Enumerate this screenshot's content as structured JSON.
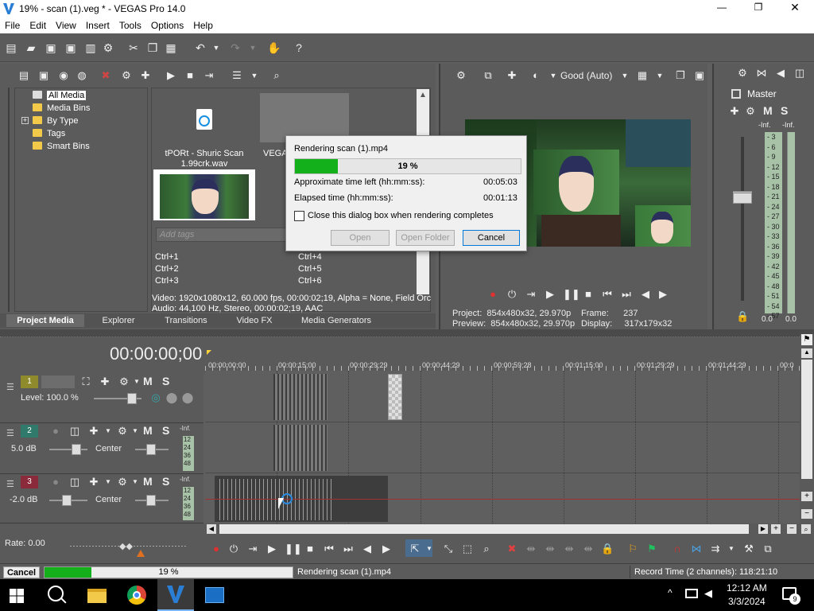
{
  "window": {
    "title": "19% - scan (1).veg * - VEGAS Pro 14.0",
    "controls": [
      "—",
      "❐",
      "✕"
    ]
  },
  "menu": [
    "File",
    "Edit",
    "View",
    "Insert",
    "Tools",
    "Options",
    "Help"
  ],
  "media_tree": {
    "items": [
      "All Media",
      "Media Bins",
      "By Type",
      "Tags",
      "Smart Bins"
    ],
    "expand_glyph": "+"
  },
  "media_files": [
    {
      "name": "tPORt - Shuric Scan 1.99crk.wav"
    },
    {
      "name": "VEGA"
    }
  ],
  "tags": {
    "placeholder": "Add tags",
    "shortcuts_left": [
      "Ctrl+1",
      "Ctrl+2",
      "Ctrl+3"
    ],
    "shortcuts_right": [
      "Ctrl+4",
      "Ctrl+5",
      "Ctrl+6"
    ]
  },
  "media_info": {
    "video": "Video: 1920x1080x12, 60.000 fps, 00:00:02;19, Alpha = None, Field Orc",
    "audio": "Audio: 44,100 Hz, Stereo, 00:00:02;19, AAC"
  },
  "bottom_tabs": [
    "Project Media",
    "Explorer",
    "Transitions",
    "Video FX",
    "Media Generators"
  ],
  "preview": {
    "quality": "Good (Auto)",
    "project": "Project:  854x480x32, 29.970p",
    "preview": "Preview:  854x480x32, 29.970p",
    "frame": "Frame:      237",
    "display": "Display:     317x179x32"
  },
  "master": {
    "title": "Master",
    "labels": [
      "M",
      "S"
    ],
    "inf_left": "-Inf.",
    "inf_right": "-Inf.",
    "scale": [
      "3",
      "6",
      "9",
      "12",
      "15",
      "18",
      "21",
      "24",
      "27",
      "30",
      "33",
      "36",
      "39",
      "42",
      "45",
      "48",
      "51",
      "54",
      "57"
    ],
    "bottom_left": "0.0",
    "bottom_right": "0.0"
  },
  "render_dialog": {
    "title": "Rendering scan (1).mp4",
    "progress_percent": 19,
    "progress_label": "19 %",
    "time_left_label": "Approximate time left (hh:mm:ss):",
    "time_left_value": "00:05:03",
    "elapsed_label": "Elapsed time (hh:mm:ss):",
    "elapsed_value": "00:01:13",
    "checkbox_label": "Close this dialog box when rendering completes",
    "buttons": {
      "open": "Open",
      "open_folder": "Open Folder",
      "cancel": "Cancel"
    }
  },
  "timeline": {
    "timecode": "00:00:00;00",
    "ruler": [
      "00:00:00;00",
      "00:00:15;00",
      "00:00:29;29",
      "00:00:44;29",
      "00:00:59;28",
      "00:01:15;00",
      "00:01:29;29",
      "00:01:44;29",
      "00:0"
    ],
    "tracks": [
      {
        "number": "1",
        "type": "video",
        "level": "Level: 100.0 %",
        "m": "M",
        "s": "S"
      },
      {
        "number": "2",
        "type": "audio",
        "volume": "5.0 dB",
        "pan": "Center",
        "m": "M",
        "s": "S",
        "meter": [
          "-Inf.",
          "12",
          "24",
          "36",
          "48"
        ]
      },
      {
        "number": "3",
        "type": "audio",
        "volume": "-2.0 dB",
        "pan": "Center",
        "m": "M",
        "s": "S",
        "meter": [
          "-Inf.",
          "12",
          "24",
          "36",
          "48"
        ]
      }
    ],
    "rate": "Rate: 0.00"
  },
  "status": {
    "cancel": "Cancel",
    "progress_percent": 19,
    "progress_label": "19 %",
    "rendering": "Rendering scan (1).mp4",
    "record_time": "Record Time (2 channels): 118:21:10"
  },
  "taskbar": {
    "time": "12:12 AM",
    "date": "3/3/2024",
    "notification_count": "9"
  },
  "colors": {
    "accent_green": "#14b01c",
    "track_red": "#c0392b"
  }
}
